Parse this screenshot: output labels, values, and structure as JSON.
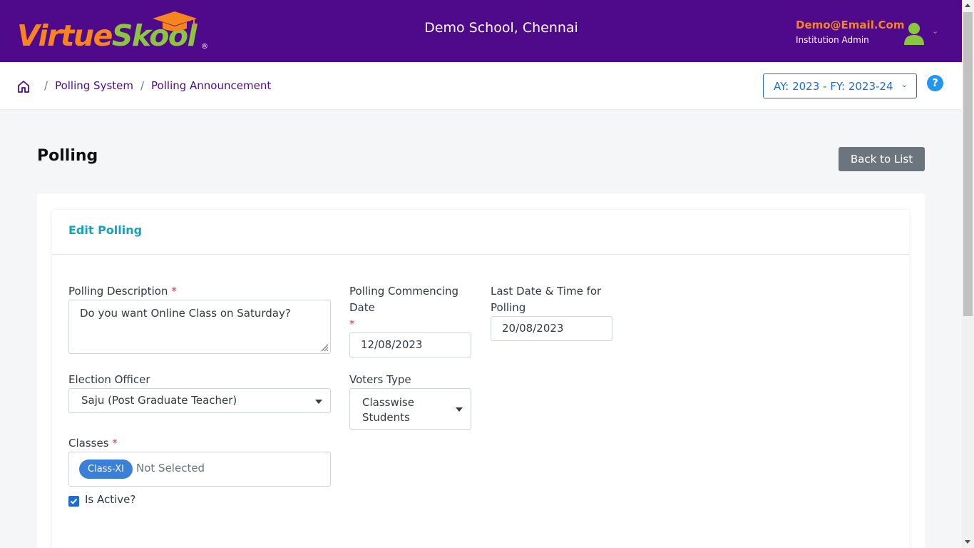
{
  "header": {
    "logo_text_1": "Virtue",
    "logo_text_2": "Skool",
    "logo_reg": "®",
    "school_name": "Demo School, Chennai",
    "user_email": "Demo@Email.Com",
    "user_role": "Institution Admin"
  },
  "breadcrumb": {
    "items": [
      "Polling System",
      "Polling Announcement"
    ],
    "separator": "/"
  },
  "academic_year": {
    "selected": "AY: 2023 - FY: 2023-24"
  },
  "help": {
    "glyph": "?"
  },
  "page": {
    "title": "Polling",
    "back_label": "Back to List",
    "card_title": "Edit Polling"
  },
  "form": {
    "description": {
      "label": "Polling Description",
      "required": "*",
      "value": "Do you want Online Class on Saturday?"
    },
    "commencing_date": {
      "label_line1": "Polling Commencing",
      "label_line2": "Date",
      "required": "*",
      "value": "12/08/2023"
    },
    "last_date": {
      "label_line1": "Last Date & Time for",
      "label_line2": "Polling",
      "value": "20/08/2023"
    },
    "election_officer": {
      "label": "Election Officer",
      "value": "Saju (Post Graduate Teacher)"
    },
    "voters_type": {
      "label": "Voters Type",
      "value_line1": "Classwise",
      "value_line2": "Students"
    },
    "classes": {
      "label": "Classes",
      "required": "*",
      "selected_chip": "Class-XI",
      "placeholder": "Not Selected"
    },
    "is_active": {
      "label": "Is Active?",
      "checked": true
    }
  },
  "colors": {
    "header_bg": "#4f0a8c",
    "accent_orange": "#f7841e",
    "accent_green": "#8cc63f",
    "link_blue": "#1b6ed8",
    "card_title": "#17a2b8",
    "back_button": "#6c757d"
  }
}
